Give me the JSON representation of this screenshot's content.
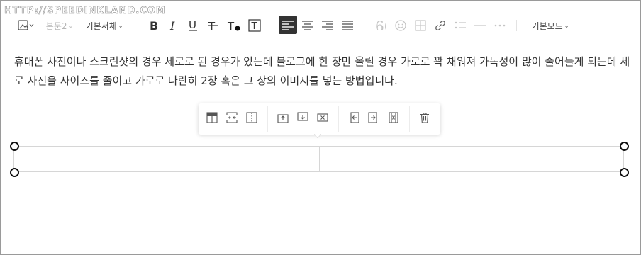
{
  "watermark": "HTTP://SPEEDINKLAND.COM",
  "toolbar": {
    "paragraph_style": "본문2",
    "font_family": "기본서체",
    "mode": "기본모드",
    "icons": [
      "image-icon",
      "bold-icon",
      "italic-icon",
      "underline-icon",
      "strikethrough-icon",
      "text-color-icon",
      "text-background-icon",
      "align-left-icon",
      "align-center-icon",
      "align-right-icon",
      "align-justify-icon",
      "quote-icon",
      "emoji-icon",
      "table-icon",
      "link-icon",
      "list-icon",
      "horizontal-rule-icon",
      "more-icon"
    ],
    "active_align": "left",
    "accent_color": "#333333"
  },
  "content": {
    "paragraph": "휴대폰 사진이나 스크린샷의 경우 세로로 된 경우가 있는데 블로그에 한 장만 올릴 경우 가로로 꽉 채워져 가독성이 많이 줄어들게 되는데 세로 사진을 사이즈를 줄이고 가로로 나란히 2장 혹은 그 상의 이미지를 넣는 방법입니다."
  },
  "table_menu": {
    "icons": [
      "table-header-icon",
      "merge-cells-icon",
      "split-cells-icon",
      "insert-row-above-icon",
      "insert-row-below-icon",
      "delete-row-icon",
      "insert-col-left-icon",
      "insert-col-right-icon",
      "delete-col-icon",
      "trash-icon"
    ]
  },
  "table": {
    "rows": 1,
    "cols": 2,
    "cells": [
      "",
      ""
    ]
  }
}
